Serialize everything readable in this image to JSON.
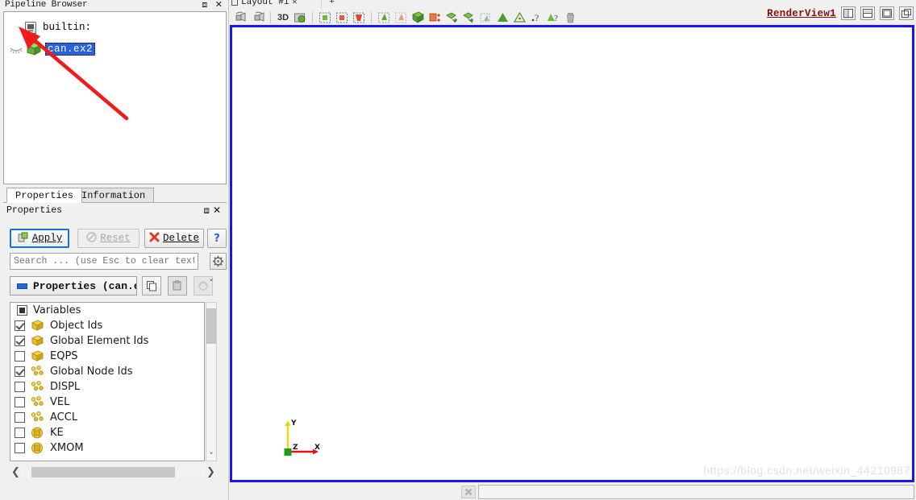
{
  "pipeline": {
    "dock_title": "Pipeline Browser",
    "dock_float_icon": "restore-icon",
    "dock_close_icon": "close-icon",
    "items": [
      {
        "label": "builtin:",
        "icon": "server-icon",
        "selected": false
      },
      {
        "label": "can.ex2",
        "icon": "green-cube-icon",
        "visibility_icon": "eye-closed-icon",
        "selected": true
      }
    ]
  },
  "annotation": {
    "arrow_color": "#f01c1c",
    "name": "red-pointer-arrow"
  },
  "prop_tabs": [
    {
      "label": "Properties",
      "active": true
    },
    {
      "label": "Information",
      "active": false
    }
  ],
  "properties": {
    "dock_title": "Properties",
    "buttons": {
      "apply": "Apply",
      "reset": "Reset",
      "delete": "Delete",
      "help": "?"
    },
    "search": {
      "placeholder": "Search ... (use Esc to clear text)",
      "value": "",
      "gear_icon": "gear-icon"
    },
    "group_header": "Properties (can.e",
    "copy_icon": "copy-icon",
    "paste_icon": "paste-icon",
    "restore_icon": "restore-defaults-icon",
    "variables": {
      "header_label": "Variables",
      "header_state": "partial",
      "rows": [
        {
          "label": "Object Ids",
          "checked": true,
          "type": "cell"
        },
        {
          "label": "Global Element Ids",
          "checked": true,
          "type": "cell"
        },
        {
          "label": "EQPS",
          "checked": false,
          "type": "cell"
        },
        {
          "label": "Global Node Ids",
          "checked": true,
          "type": "point"
        },
        {
          "label": "DISPL",
          "checked": false,
          "type": "point"
        },
        {
          "label": "VEL",
          "checked": false,
          "type": "point"
        },
        {
          "label": "ACCL",
          "checked": false,
          "type": "point"
        },
        {
          "label": "KE",
          "checked": false,
          "type": "field"
        },
        {
          "label": "XMOM",
          "checked": false,
          "type": "field"
        }
      ]
    },
    "scroll_up_icon": "chevron-up-icon",
    "scroll_down_icon": "chevron-down-icon",
    "hscroll_left_icon": "chevron-left-icon",
    "hscroll_right_icon": "chevron-right-icon"
  },
  "layout": {
    "tab_label": "Layout #1",
    "tab_close": "✕",
    "new_tab": "+"
  },
  "toolbar": {
    "items": [
      {
        "name": "camera-undo-icon"
      },
      {
        "name": "camera-redo-icon"
      },
      {
        "name": "separator"
      },
      {
        "name": "mode-3d-label",
        "text": "3D"
      },
      {
        "name": "camera-interaction-icon"
      },
      {
        "name": "separator"
      },
      {
        "name": "select-cells-surface-icon"
      },
      {
        "name": "select-points-surface-icon"
      },
      {
        "name": "select-cells-frustum-icon"
      },
      {
        "name": "separator"
      },
      {
        "name": "select-cells-polygon-icon"
      },
      {
        "name": "select-points-polygon-icon"
      },
      {
        "name": "select-block-icon"
      },
      {
        "name": "interactive-select-cells-icon"
      },
      {
        "name": "interactive-select-points-icon"
      },
      {
        "name": "hover-cells-icon"
      },
      {
        "name": "hover-points-icon"
      },
      {
        "name": "plot-selection-icon"
      },
      {
        "name": "extract-selection-icon"
      },
      {
        "name": "find-data-icon"
      },
      {
        "name": "query-icon"
      },
      {
        "name": "clear-selection-icon"
      }
    ]
  },
  "render_view": {
    "title": "RenderView1",
    "buttons": [
      {
        "name": "split-horizontal-button",
        "icon": "split-horizontal-icon"
      },
      {
        "name": "split-vertical-button",
        "icon": "split-vertical-icon"
      },
      {
        "name": "maximize-button",
        "icon": "maximize-icon"
      },
      {
        "name": "undock-button",
        "icon": "undock-icon"
      }
    ],
    "border_color": "#1a15e8",
    "background": "#ffffff",
    "axes": {
      "x_label": "X",
      "x_color": "#e81010",
      "y_label": "Y",
      "y_color": "#e8d810",
      "z_label": "Z",
      "z_color": "#18a018"
    },
    "watermark": "https://blog.csdn.net/weixin_44210987"
  },
  "status_bar": {
    "cancel_icon": "cancel-icon",
    "progress_value": ""
  }
}
